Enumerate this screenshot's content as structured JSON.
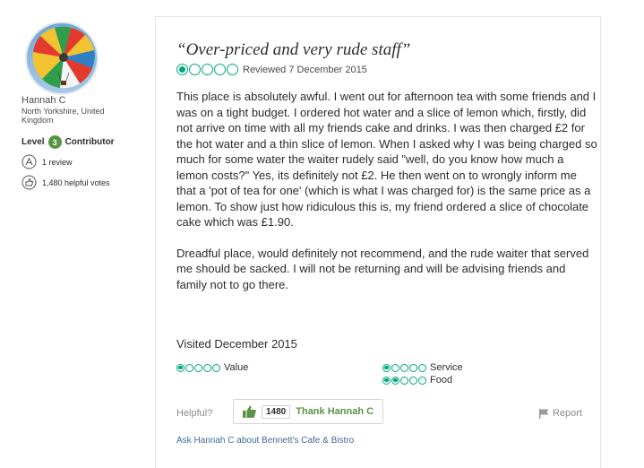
{
  "reviewer": {
    "avatar_icon": "hot-air-balloon-photo",
    "name": "Hannah C",
    "location": "North Yorkshire, United Kingdom",
    "level_prefix": "Level",
    "level_number": "3",
    "level_label": "Contributor",
    "reviews_text": "1 review",
    "helpful_votes_text": "1,480 helpful votes"
  },
  "review": {
    "title": "“Over-priced and very rude staff”",
    "rating": 1,
    "rating_max": 5,
    "reviewed_date": "Reviewed 7 December 2015",
    "paragraphs": [
      "This place is absolutely awful. I went out for afternoon tea with some friends and I was on a tight budget. I ordered hot water and a slice of lemon which, firstly, did not arrive on time with all my friends cake and drinks. I was then charged £2 for the hot water and a thin slice of lemon. When I asked why I was being charged so much for some water the waiter rudely said \"well, do you know how much a lemon costs?\" Yes, its definitely not £2. He then went on to wrongly inform me that a 'pot of tea for one' (which is what I was charged for) is the same price as a lemon. To show just how ridiculous this is, my friend ordered a slice of chocolate cake which was £1.90.",
      "Dreadful place, would definitely not recommend, and the rude waiter that served me should be sacked. I will not be returning and will be advising friends and family not to go there."
    ],
    "visited": "Visited December 2015",
    "subratings": {
      "value": {
        "label": "Value",
        "rating": 1
      },
      "service": {
        "label": "Service",
        "rating": 1
      },
      "food": {
        "label": "Food",
        "rating": 2
      }
    }
  },
  "actions": {
    "helpful_label": "Helpful?",
    "thank_count": "1480",
    "thank_label": "Thank Hannah C",
    "report_label": "Report",
    "ask_link": "Ask Hannah C about Bennett's Cafe & Bistro"
  },
  "colors": {
    "bubble": "#00a680",
    "level_badge": "#589442",
    "thank_text": "#589442",
    "link": "#3d6b99"
  }
}
